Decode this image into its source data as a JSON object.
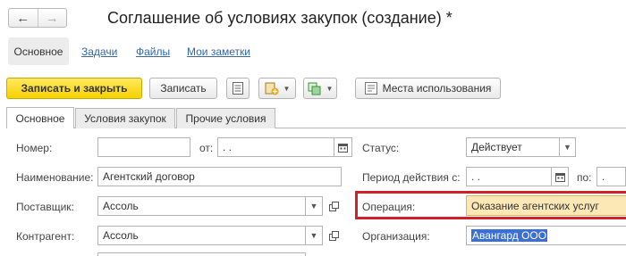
{
  "window": {
    "title": "Соглашение об условиях закупок (создание) *",
    "nav_back_icon": "arrow-left-icon",
    "nav_forward_icon": "arrow-right-icon"
  },
  "top_links": {
    "main": "Основное",
    "tasks": "Задачи",
    "files": "Файлы",
    "notes": "Мои заметки"
  },
  "toolbar": {
    "save_close": "Записать и закрыть",
    "save": "Записать",
    "usage": "Места использования"
  },
  "tabs": [
    {
      "label": "Основное",
      "active": true
    },
    {
      "label": "Условия закупок",
      "active": false
    },
    {
      "label": "Прочие условия",
      "active": false
    }
  ],
  "form": {
    "number": {
      "label": "Номер:",
      "value": ""
    },
    "from": {
      "label": "от:",
      "value": " .  ."
    },
    "name": {
      "label": "Наименование:",
      "value": "Агентский договор"
    },
    "supplier": {
      "label": "Поставщик:",
      "value": "Ассоль"
    },
    "counterparty": {
      "label": "Контрагент:",
      "value": "Ассоль"
    },
    "status": {
      "label": "Статус:",
      "value": "Действует"
    },
    "period": {
      "label": "Период действия с:",
      "from_value": " .  .",
      "to_label": "по:",
      "to_value": " ."
    },
    "operation": {
      "label": "Операция:",
      "value": "Оказание агентских услуг"
    },
    "organization": {
      "label": "Организация:",
      "value": "Авангард ООО"
    }
  },
  "colors": {
    "primary_button": "#f6d100",
    "highlight_border": "#d0202a",
    "operation_fill": "#fbe8b4",
    "selection": "#3c6fd6",
    "link": "#3366aa"
  }
}
